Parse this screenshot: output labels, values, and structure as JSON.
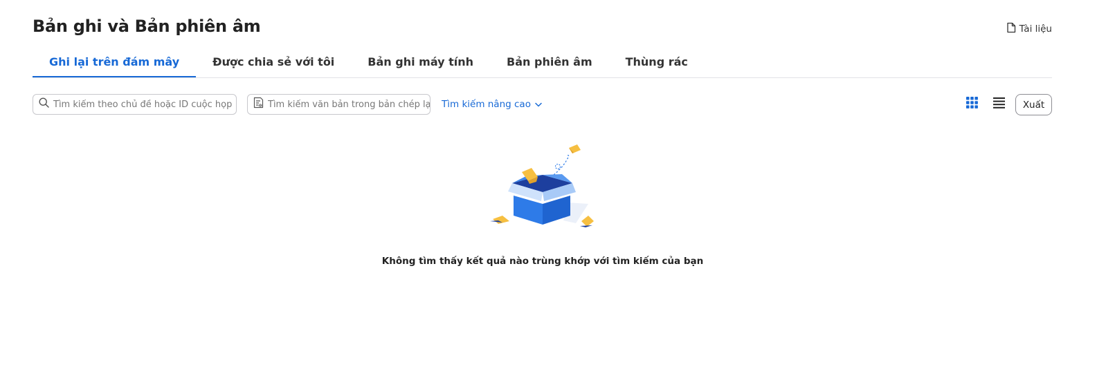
{
  "header": {
    "title": "Bản ghi và Bản phiên âm",
    "docs_link": "Tài liệu"
  },
  "tabs": [
    {
      "label": "Ghi lại trên đám mây",
      "active": true
    },
    {
      "label": "Được chia sẻ với tôi",
      "active": false
    },
    {
      "label": "Bản ghi máy tính",
      "active": false
    },
    {
      "label": "Bản phiên âm",
      "active": false
    },
    {
      "label": "Thùng rác",
      "active": false
    }
  ],
  "toolbar": {
    "topic_search_placeholder": "Tìm kiếm theo chủ đề hoặc ID cuộc họp",
    "transcript_search_placeholder": "Tìm kiếm văn bản trong bản chép lại âm thanh",
    "advanced_search_label": "Tìm kiếm nâng cao",
    "export_label": "Xuất",
    "active_view": "grid"
  },
  "empty_state": {
    "message": "Không tìm thấy kết quả nào trùng khớp với tìm kiếm của bạn"
  },
  "colors": {
    "accent": "#1769d6",
    "box_blue": "#2e7be8",
    "paper_yellow": "#f6bf41"
  }
}
